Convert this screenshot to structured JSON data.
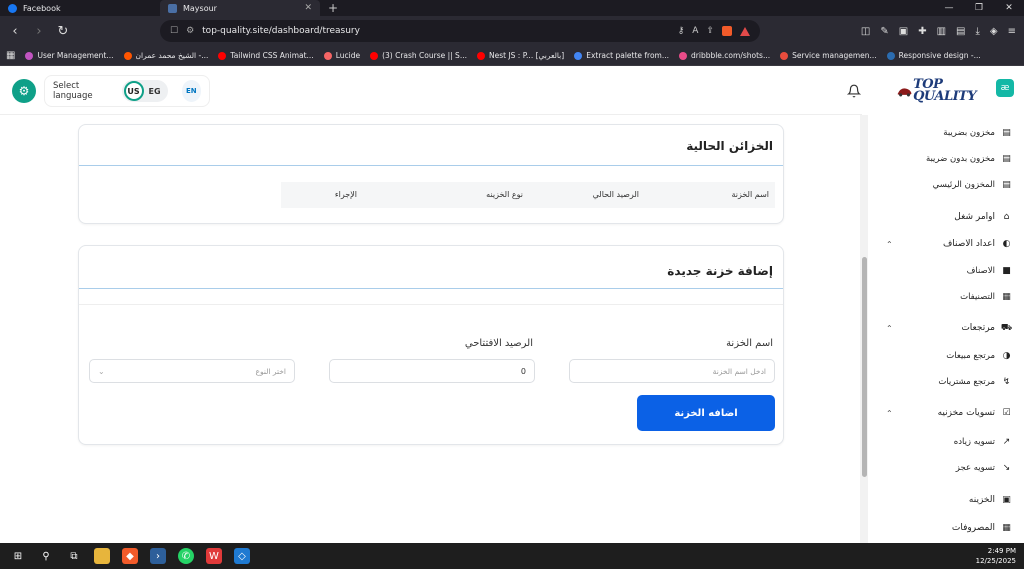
{
  "browser": {
    "tabs": [
      {
        "label": "Facebook",
        "color": "#1877f2"
      },
      {
        "label": "Maysour",
        "color": "#4a6fa5"
      }
    ],
    "url": "top-quality.site/dashboard/treasury",
    "bookmarks": [
      {
        "label": "User Management...",
        "color": "#c154c1"
      },
      {
        "label": "الشيخ محمد عمران -...",
        "color": "#ff5500"
      },
      {
        "label": "Tailwind CSS Animat...",
        "color": "#ff0000"
      },
      {
        "label": "Lucide",
        "color": "#f56565"
      },
      {
        "label": "(3) Crash Course || S...",
        "color": "#ff0000"
      },
      {
        "label": "Nest JS : P... [بالعربي]",
        "color": "#ff0000"
      },
      {
        "label": "Extract palette from...",
        "color": "#4285f4"
      },
      {
        "label": "dribbble.com/shots...",
        "color": "#ea4c89"
      },
      {
        "label": "Service managemen...",
        "color": "#e84c3d"
      },
      {
        "label": "Responsive design -...",
        "color": "#2b6cb0"
      }
    ]
  },
  "header": {
    "select_language": "Select language",
    "lang_us": "US",
    "lang_eg": "EG",
    "lang_en": "EN"
  },
  "treasury_list": {
    "title": "الخزائن الحالية",
    "columns": [
      "اسم الخزنة",
      "الرصيد الحالي",
      "نوع الخزينه",
      "الإجراء"
    ]
  },
  "add_form": {
    "title": "إضافة خزنة جديدة",
    "name_label": "اسم الخزنة",
    "name_placeholder": "ادخل اسم الخزنة",
    "balance_label": "الرصيد الافتتاحي",
    "balance_value": "0",
    "type_placeholder": "اختر النوع",
    "submit_label": "اضافه الخزنة"
  },
  "sidebar": {
    "logo": "TOP QUALITY",
    "items": [
      {
        "label": "مخزون بضريبة",
        "icon": "archive-icon",
        "sub": true
      },
      {
        "label": "مخزون بدون ضريبة",
        "icon": "archive-icon",
        "sub": true
      },
      {
        "label": "المخزون الرئيسي",
        "icon": "archive-icon",
        "sub": true
      },
      {
        "label": "اوامر شغل",
        "icon": "factory-icon",
        "sub": false
      },
      {
        "label": "اعداد الاصناف",
        "icon": "moon-icon",
        "sub": false,
        "caret": true
      },
      {
        "label": "الاصناف",
        "icon": "box-icon",
        "sub": true
      },
      {
        "label": "التصنيفات",
        "icon": "grid-icon",
        "sub": true
      },
      {
        "label": "مرتجعات",
        "icon": "truck-icon",
        "sub": false,
        "caret": true
      },
      {
        "label": "مرتجع مبيعات",
        "icon": "return-icon",
        "sub": true
      },
      {
        "label": "مرتجع مشتريات",
        "icon": "return-purchase-icon",
        "sub": true
      },
      {
        "label": "تسويات مخزنيه",
        "icon": "clipboard-icon",
        "sub": false,
        "caret": true
      },
      {
        "label": "تسويه زياده",
        "icon": "trend-up-icon",
        "sub": true
      },
      {
        "label": "تسويه عجز",
        "icon": "trend-down-icon",
        "sub": true
      },
      {
        "label": "الخزينه",
        "icon": "safe-icon",
        "sub": false
      },
      {
        "label": "المصروفات",
        "icon": "expenses-icon",
        "sub": false
      }
    ]
  },
  "taskbar": {
    "time": "2:49 PM",
    "date": "12/25/2025"
  }
}
